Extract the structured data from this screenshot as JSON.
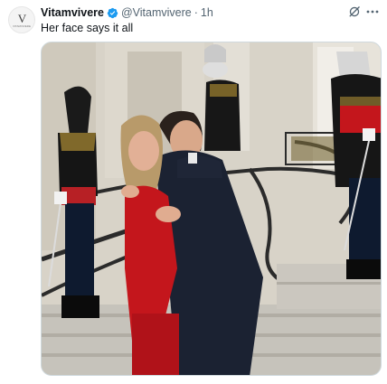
{
  "tweet": {
    "display_name": "Vitamvivere",
    "handle": "@Vitamvivere",
    "separator": "·",
    "time": "1h",
    "text": "Her face says it all",
    "avatar": {
      "monogram": "V",
      "subtitle": "VITAMVIVERE"
    },
    "icons": {
      "verified": "verified-badge-icon",
      "grok": "grok-icon",
      "more": "more-options-icon"
    },
    "colors": {
      "verified": "#1d9bf0",
      "secondary_text": "#536471",
      "accent_red": "#c4161c"
    }
  }
}
